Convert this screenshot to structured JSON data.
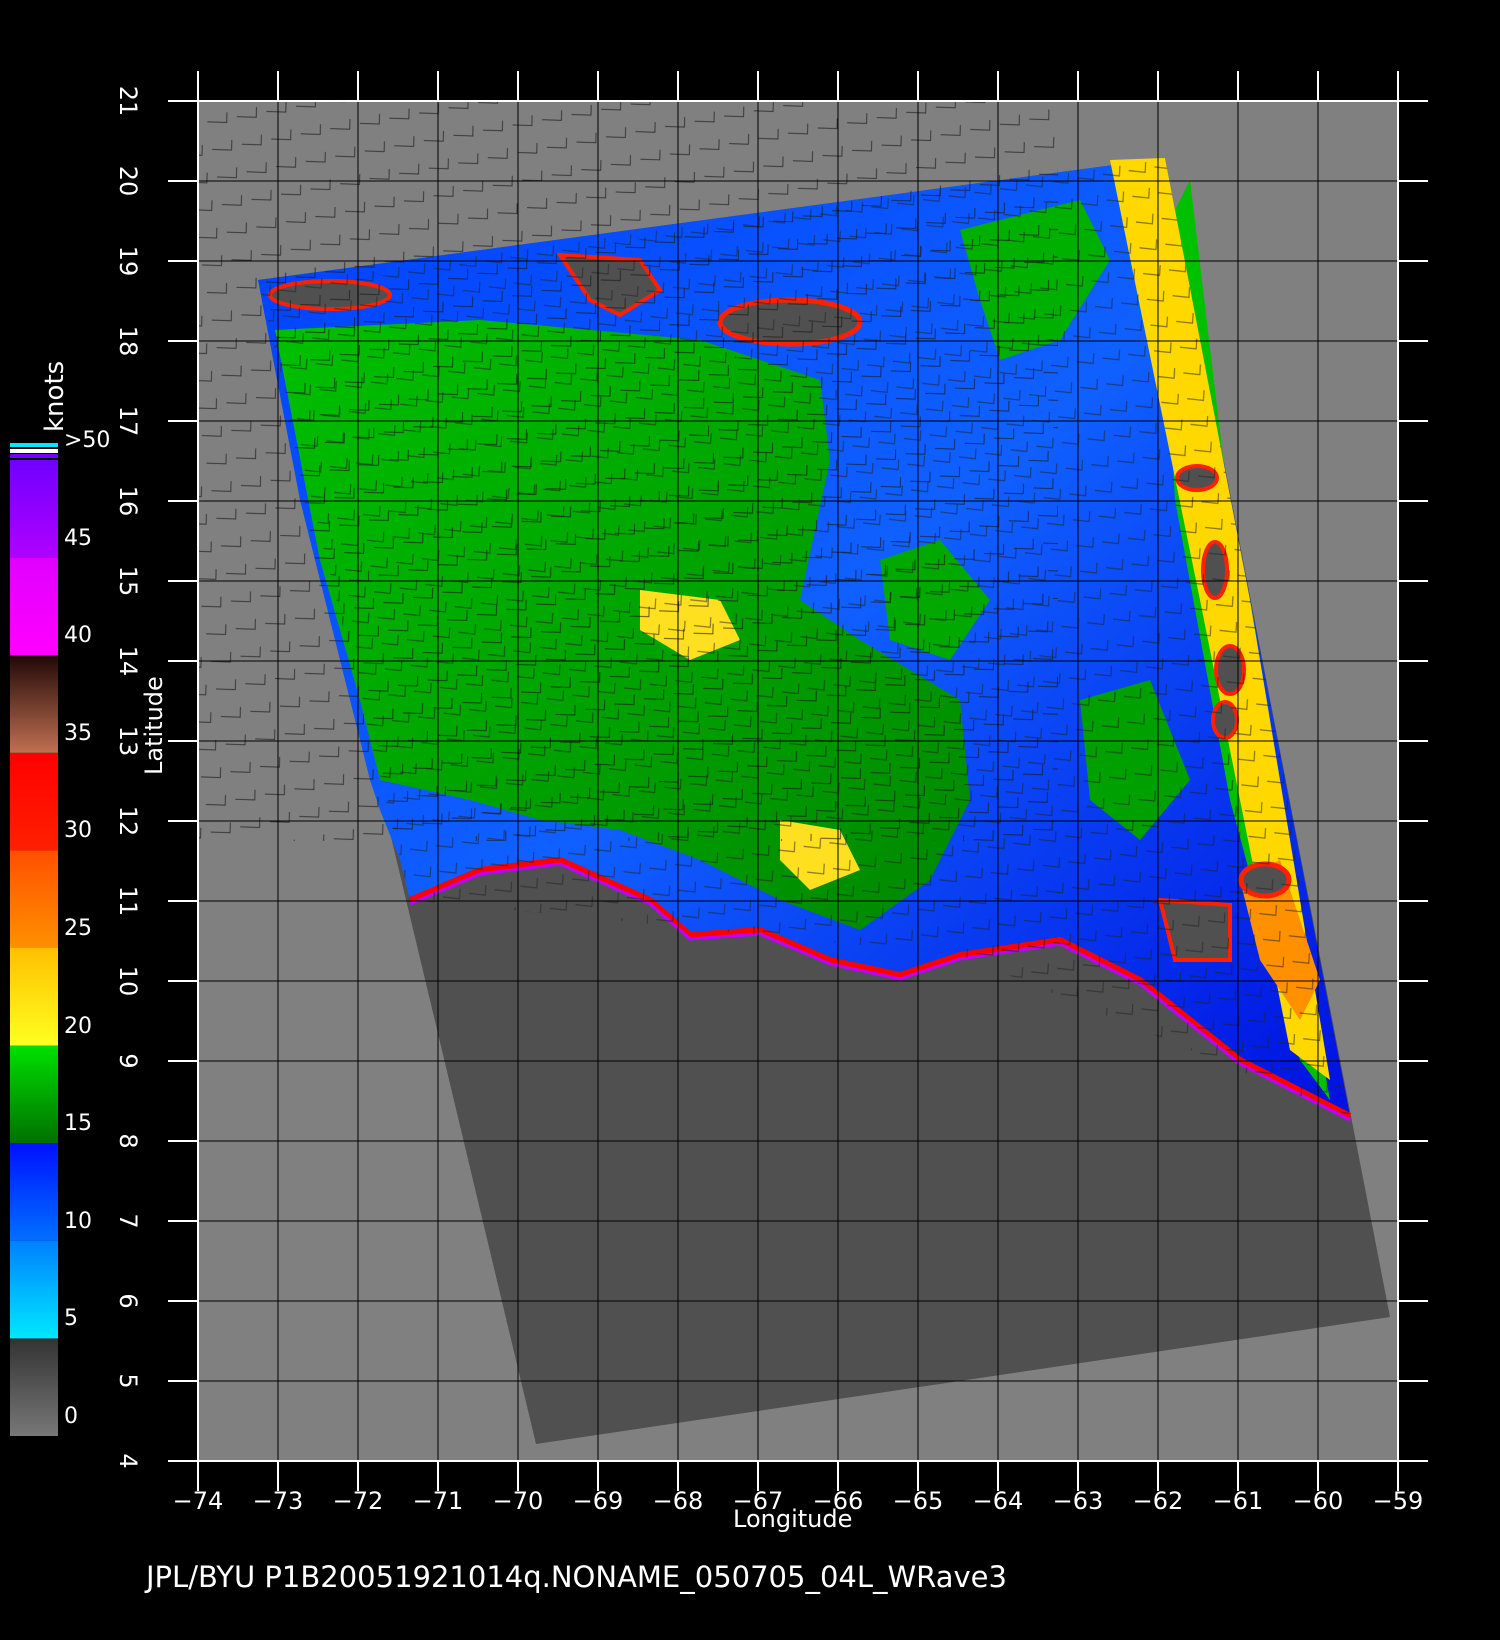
{
  "map": {
    "x_ticks": [
      "−74",
      "−73",
      "−72",
      "−71",
      "−70",
      "−69",
      "−68",
      "−67",
      "−66",
      "−65",
      "−64",
      "−63",
      "−62",
      "−61",
      "−60",
      "−59"
    ],
    "y_ticks": [
      "4",
      "5",
      "6",
      "7",
      "8",
      "9",
      "10",
      "11",
      "12",
      "13",
      "14",
      "15",
      "16",
      "17",
      "18",
      "19",
      "20",
      "21"
    ],
    "xlabel": "Longitude",
    "ylabel": "Latitude",
    "footer": "JPL/BYU  P1B20051921014q.NONAME_050705_04L_WRave3",
    "colors": {
      "background": "#000000",
      "plot_area": "#808080",
      "swath_land": "#505050",
      "grid": "#000000"
    },
    "lon_range": [
      -74,
      -59
    ],
    "lat_range": [
      4,
      21
    ]
  },
  "colorbar": {
    "title": "knots",
    "labels": [
      ">50",
      "45",
      "40",
      "35",
      "30",
      "25",
      "20",
      "15",
      "10",
      "5",
      "0"
    ],
    "bands": [
      {
        "from": 0,
        "to": 5,
        "color_top": "#333333",
        "color_bottom": "#777777"
      },
      {
        "from": 5,
        "to": 10,
        "color_top": "#0080ff",
        "color_bottom": "#00e8ff"
      },
      {
        "from": 10,
        "to": 15,
        "color_top": "#0010ff",
        "color_bottom": "#0070ff"
      },
      {
        "from": 15,
        "to": 20,
        "color_top": "#00e000",
        "color_bottom": "#007000"
      },
      {
        "from": 20,
        "to": 25,
        "color_top": "#ffc000",
        "color_bottom": "#ffff20"
      },
      {
        "from": 25,
        "to": 30,
        "color_top": "#ff5000",
        "color_bottom": "#ff9000"
      },
      {
        "from": 30,
        "to": 35,
        "color_top": "#ff0000",
        "color_bottom": "#ff2000"
      },
      {
        "from": 35,
        "to": 40,
        "color_top": "#200808",
        "color_bottom": "#c07050"
      },
      {
        "from": 40,
        "to": 45,
        "color_top": "#e000ff",
        "color_bottom": "#ff00ff"
      },
      {
        "from": 45,
        "to": 50,
        "color_top": "#7000ff",
        "color_bottom": "#b000ff"
      }
    ]
  }
}
